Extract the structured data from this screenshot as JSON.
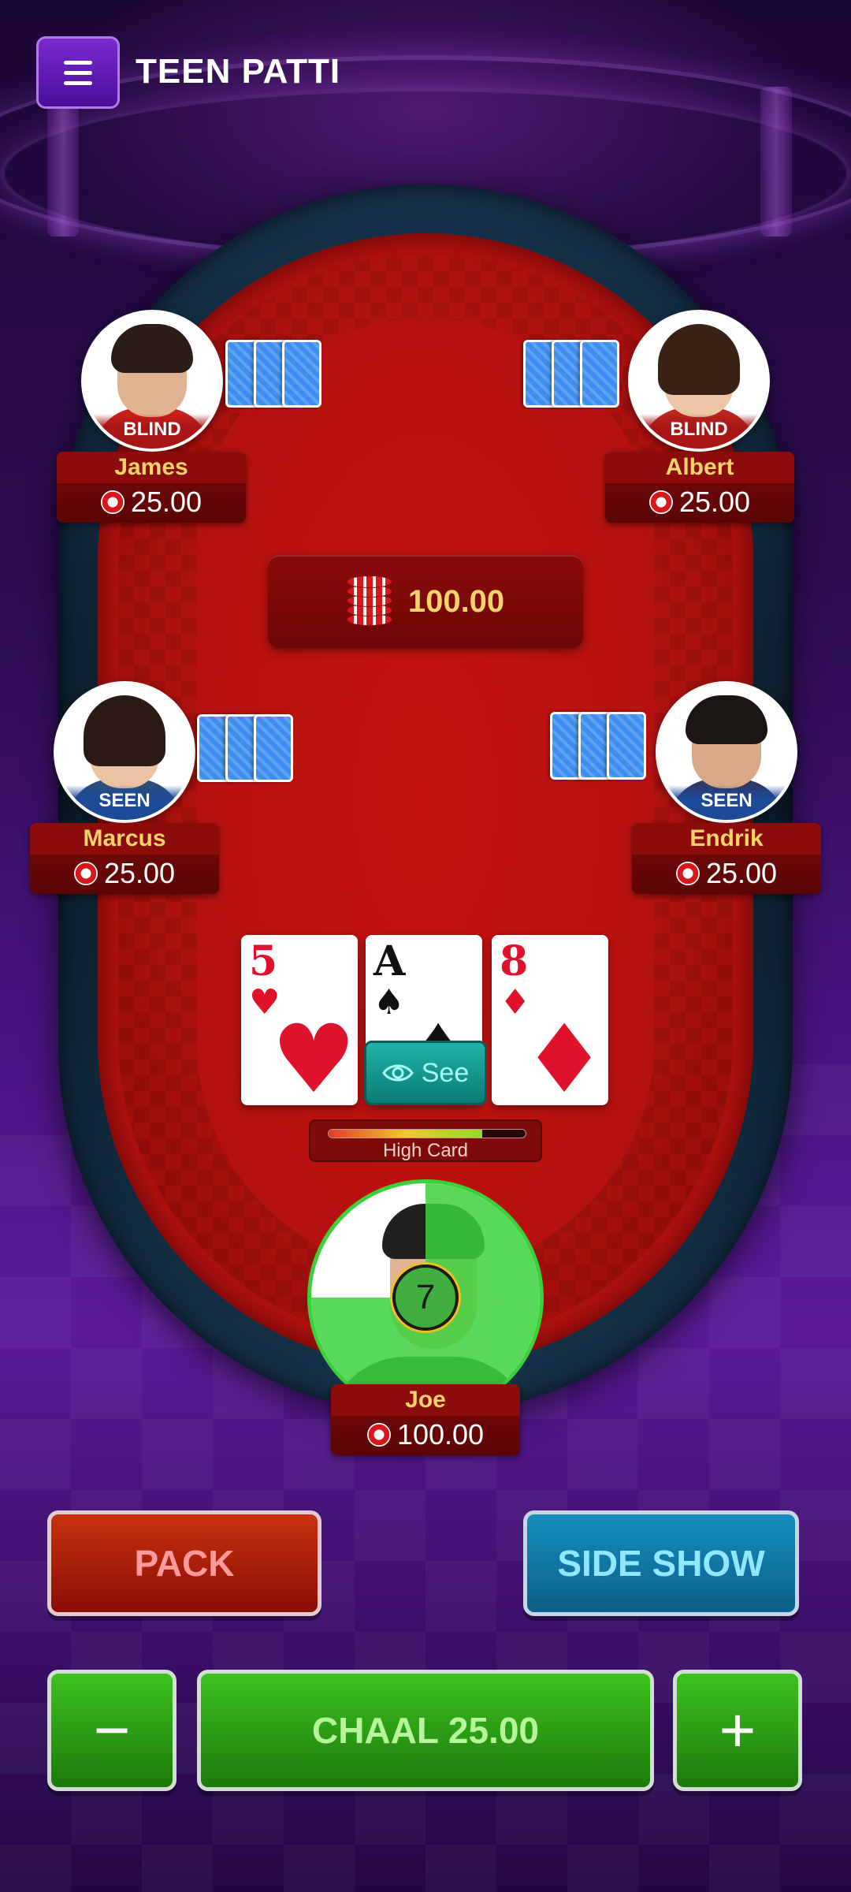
{
  "header": {
    "title": "TEEN PATTI",
    "menu_icon": "hamburger-menu-icon"
  },
  "pot": {
    "amount": "100.00",
    "icon": "chip-stack-icon"
  },
  "players": [
    {
      "name": "James",
      "status": "BLIND",
      "amount": "25.00",
      "cards_face_down": 3
    },
    {
      "name": "Albert",
      "status": "BLIND",
      "amount": "25.00",
      "cards_face_down": 3
    },
    {
      "name": "Marcus",
      "status": "SEEN",
      "amount": "25.00",
      "cards_face_down": 3
    },
    {
      "name": "Endrik",
      "status": "SEEN",
      "amount": "25.00",
      "cards_face_down": 3
    }
  ],
  "me": {
    "name": "Joe",
    "amount": "100.00",
    "turn_counter": "7",
    "timer_fraction_remaining": 0.75,
    "cards": [
      {
        "rank": "5",
        "suit": "♥",
        "color": "#e0112b"
      },
      {
        "rank": "A",
        "suit": "♠",
        "color": "#111111"
      },
      {
        "rank": "8",
        "suit": "♦",
        "color": "#e0112b"
      }
    ],
    "see_button": "See",
    "hand_strength_label": "High Card",
    "hand_strength_fraction": 0.78
  },
  "actions": {
    "pack": "PACK",
    "side_show": "SIDE SHOW",
    "minus": "−",
    "chaal": "CHAAL 25.00",
    "plus": "+"
  },
  "colors": {
    "gold_text": "#f6d36a",
    "table_red": "#b3120f",
    "timer_green": "#3ad13a",
    "card_back_blue": "#3d8ef0"
  }
}
